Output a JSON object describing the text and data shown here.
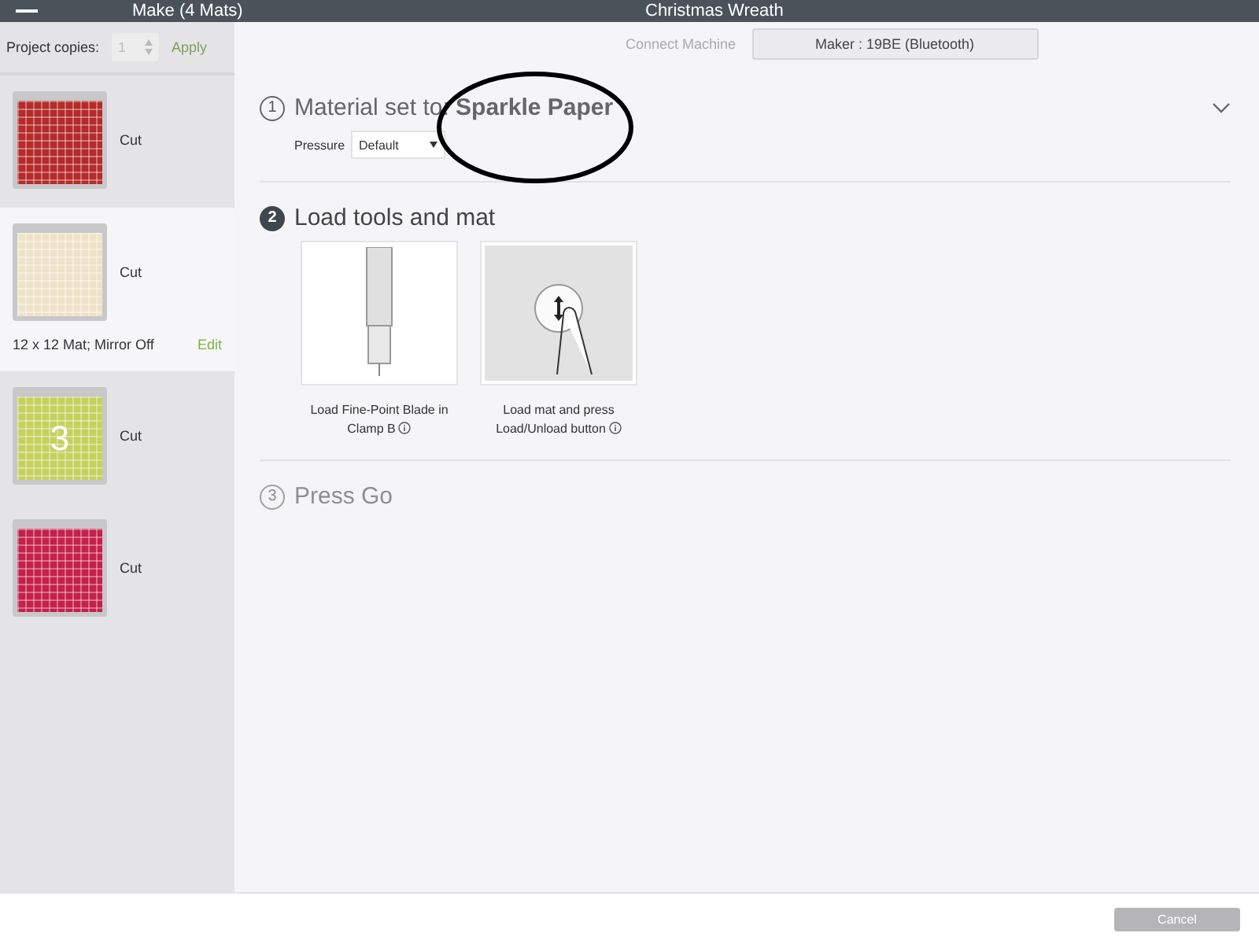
{
  "top_bar": {
    "left_title": "Make (4 Mats)",
    "center_title": "Christmas Wreath"
  },
  "project_copies": {
    "label": "Project copies:",
    "value": "1",
    "apply": "Apply",
    "disabled": true
  },
  "connect_machine": {
    "label": "Connect Machine",
    "machine": "Maker : 19BE (Bluetooth)"
  },
  "mats": [
    {
      "color": "#b52a2a",
      "label": "Cut",
      "selected": false
    },
    {
      "color": "#eee3c8",
      "label": "Cut",
      "selected": true,
      "details": "12 x 12 Mat; Mirror Off",
      "edit": "Edit"
    },
    {
      "color": "#c5d15e",
      "label": "Cut",
      "selected": false,
      "design_text": "3"
    },
    {
      "color": "#c4204a",
      "label": "Cut",
      "selected": false
    }
  ],
  "steps": [
    {
      "number": "1",
      "kind": "material",
      "current": false,
      "disabled": false,
      "title": "Material set to: **Sparkle Paper**",
      "pressure_label": "Pressure",
      "pressure_value": "Default",
      "expanded": false
    },
    {
      "number": "2",
      "kind": "tools",
      "current": true,
      "disabled": false,
      "title": "Load tools and mat",
      "cards": [
        {
          "kind": "blade",
          "caption": "Load Fine-Point Blade in Clamp B"
        },
        {
          "kind": "mat",
          "caption": "Load mat and press Load/Unload button"
        }
      ]
    },
    {
      "number": "3",
      "kind": "go",
      "current": false,
      "disabled": true,
      "title": "Press Go"
    }
  ],
  "cancel_button": {
    "label": "Cancel",
    "disabled": true
  }
}
